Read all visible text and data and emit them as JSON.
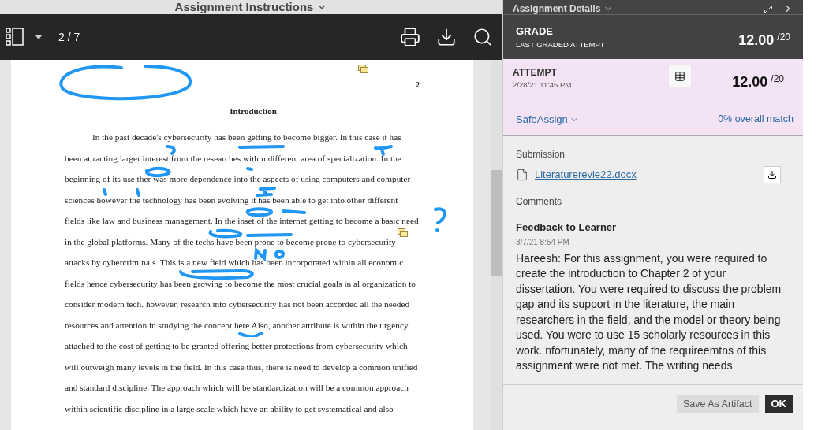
{
  "viewer": {
    "title": "Assignment Instructions",
    "page_indicator": "2 / 7",
    "document": {
      "page_number": "2",
      "heading": "Introduction",
      "lines": [
        "In the past decade's cybersecurity has been getting to become bigger. In this case it has",
        "been attracting larger interest from the researches within different area of specialization. In the",
        "beginning of its use ther was more dependence into the aspects of using computers and computer",
        "sciences however the technology has been evolving it has been able to get into other different",
        "fields like law and business management. In the inset of the internet getting to become a basic need",
        "in the global platforms. Many of the techs have been prone to become prone to cybersecurity",
        "attacks by cybercriminals. This is a new field which has been incorporated within all economic",
        "fields hence cybersecurity has been growing to become the most crucial goals in al organization to",
        "consider modern tech. however, research into cybersecurity has not been accorded all the needed",
        "resources and attention in studying the concept here Also, another attribute is within the urgency",
        "attached to the cost of getting to be granted offering better protections from cybersecurity which",
        "will outweigh many levels in the field. In this case thus, there is need to develop a common unified",
        "and standard discipline. The approach which will be standardization will be a common approach",
        "within scientific discipline in a large scale which have an ability to get systematical and also"
      ]
    }
  },
  "details": {
    "title": "Assignment Details",
    "grade": {
      "label": "GRADE",
      "sublabel": "LAST GRADED ATTEMPT",
      "score": "12.00",
      "out_of": "/20"
    },
    "attempt": {
      "label": "ATTEMPT",
      "date": "2/28/21 11:45 PM",
      "score": "12.00",
      "out_of": "/20",
      "safeassign": "SafeAssign",
      "match": "0% overall match"
    },
    "submission": {
      "label": "Submission",
      "file": "Literaturerevie22.docx"
    },
    "comments": {
      "label": "Comments",
      "title": "Feedback to Learner",
      "date": "3/7/21 8:54 PM",
      "text": "Hareesh: For this assignment, you were required to create the introduction to Chapter 2 of your dissertation. You were required to discuss the problem gap and its support in the literature, the main researchers in the field, and the model or theory being used.  You were to use 15 scholarly resources in this work. nfortunately, many of the requireemtns of this assignment were not met.  The writing needs"
    },
    "buttons": [
      "Save As Artifact",
      "OK"
    ]
  }
}
